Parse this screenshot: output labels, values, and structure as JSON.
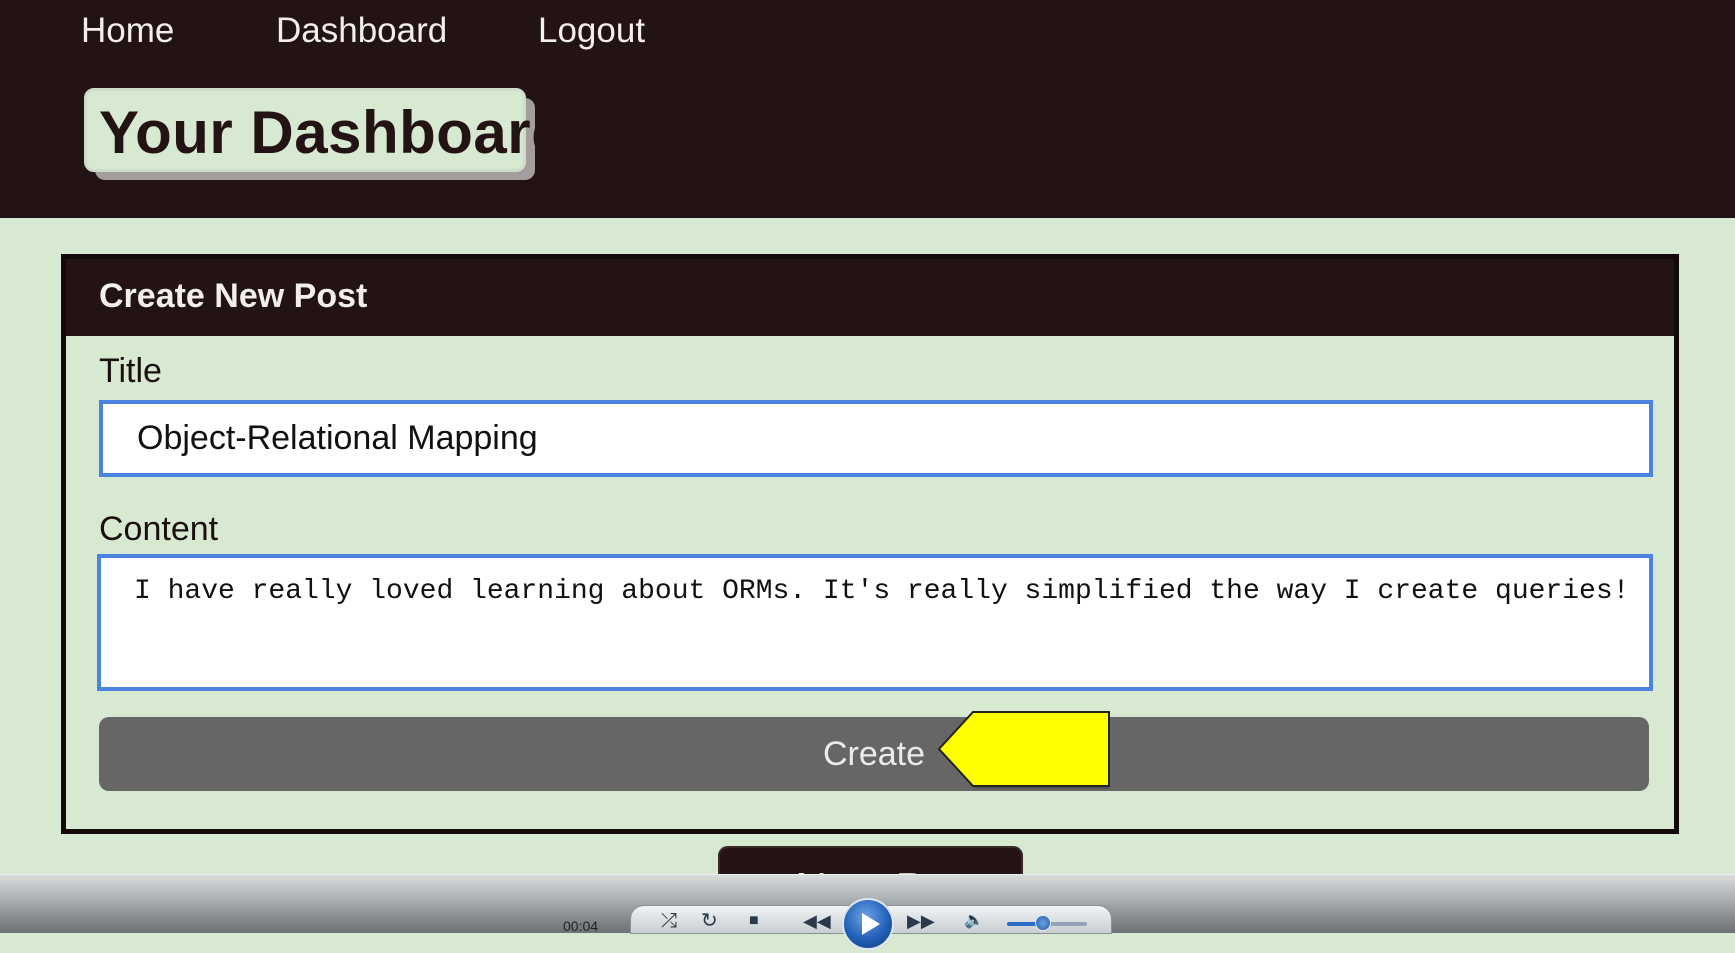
{
  "nav": {
    "home": "Home",
    "dashboard": "Dashboard",
    "logout": "Logout"
  },
  "page": {
    "title": "Your Dashboard"
  },
  "form": {
    "header": "Create New Post",
    "title_label": "Title",
    "title_value": "Object-Relational Mapping",
    "content_label": "Content",
    "content_value": "I have really loved learning about ORMs. It's really simplified the way I create queries!",
    "create_label": "Create"
  },
  "new_post": {
    "label": "+ New Post"
  },
  "player": {
    "time": "00:04",
    "volume": 0.45
  },
  "colors": {
    "header_bg": "#231314",
    "page_bg": "#d8e9d2",
    "input_border": "#4a84e0",
    "button_bg": "#666666",
    "callout_fill": "#ffff00"
  },
  "icons": {
    "callout": "yellow-arrow-pointer",
    "controls": [
      "shuffle-icon",
      "repeat-icon",
      "stop-icon",
      "previous-icon",
      "play-icon",
      "next-icon",
      "volume-icon"
    ]
  }
}
